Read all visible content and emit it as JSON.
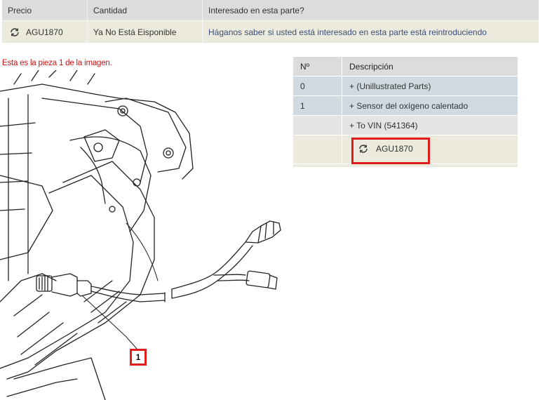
{
  "top_table": {
    "headers": [
      "Precio",
      "Cantidad",
      "Interesado en esta parte?"
    ],
    "row": {
      "part_number": "AGU1870",
      "quantity": "Ya No Está Eisponible",
      "message": "Háganos saber si usted está interesado en esta parte está reintroduciendo"
    }
  },
  "note": "Esta es la pieza 1 de la imagen.",
  "parts_table": {
    "headers": [
      "Nº",
      "Descripción"
    ],
    "rows": [
      {
        "num": "0",
        "desc": "+ (Unillustrated Parts)"
      },
      {
        "num": "1",
        "desc": "+ Sensor del oxígeno calentado"
      },
      {
        "num": "",
        "desc": "+ To VIN (541364)"
      }
    ],
    "selected_part": "AGU1870"
  },
  "callout_label": "1",
  "colors": {
    "header_bg": "#dcdcdc",
    "row_tan": "#ebeadc",
    "row_blue": "#cfdbe0",
    "highlight_red": "#e11c1c",
    "note_red": "#cc1010"
  },
  "icons": [
    "refresh-icon"
  ]
}
